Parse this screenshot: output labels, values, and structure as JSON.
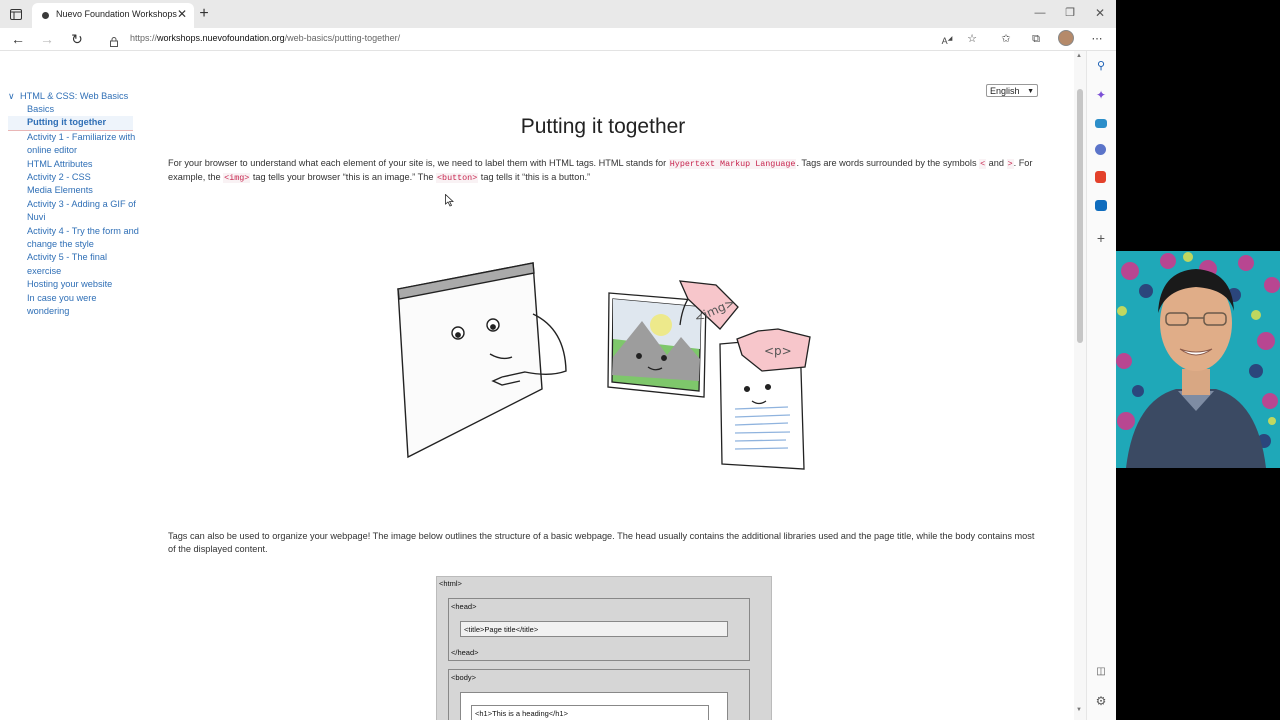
{
  "browser": {
    "tab_title": "Nuevo Foundation Workshops",
    "url_scheme": "https://",
    "url_domain": "workshops.nuevofoundation.org",
    "url_path": "/web-basics/putting-together/"
  },
  "nav": {
    "root": "HTML & CSS: Web Basics",
    "items": [
      {
        "label": "Basics"
      },
      {
        "label": "Putting it together"
      },
      {
        "label": "Activity 1 - Familiarize with online editor"
      },
      {
        "label": "HTML Attributes"
      },
      {
        "label": "Activity 2 - CSS"
      },
      {
        "label": "Media Elements"
      },
      {
        "label": "Activity 3 - Adding a GIF of Nuvi"
      },
      {
        "label": "Activity 4 - Try the form and change the style"
      },
      {
        "label": "Activity 5 - The final exercise"
      },
      {
        "label": "Hosting your website"
      },
      {
        "label": "In case you were wondering"
      }
    ]
  },
  "language": {
    "selected": "English"
  },
  "page": {
    "title": "Putting it together",
    "p1": {
      "a": "For your browser to understand what each element of your site is, we need to label them with HTML tags. HTML stands for ",
      "code1": "Hypertext Markup Language",
      "b": ". Tags are words surrounded by the symbols ",
      "code2": "<",
      "c": " and ",
      "code3": ">",
      "d": ". For example, the ",
      "code4": "<img>",
      "e": " tag tells your browser “this is an image.” The ",
      "code5": "<button>",
      "f": " tag tells it “this is a button.”"
    },
    "p2": "Tags can also be used to organize your webpage! The image below outlines the structure of a basic webpage. The head usually contains the additional libraries used and the page title, while the body contains most of the displayed content.",
    "illustration": {
      "img_tag": "<img>",
      "p_tag": "<p>"
    },
    "diagram": {
      "html_open": "<html>",
      "head_open": "<head>",
      "title_line": "<title>Page title</title>",
      "head_close": "</head>",
      "body_open": "<body>",
      "h1_line": "<h1>This is a heading</h1>"
    }
  }
}
